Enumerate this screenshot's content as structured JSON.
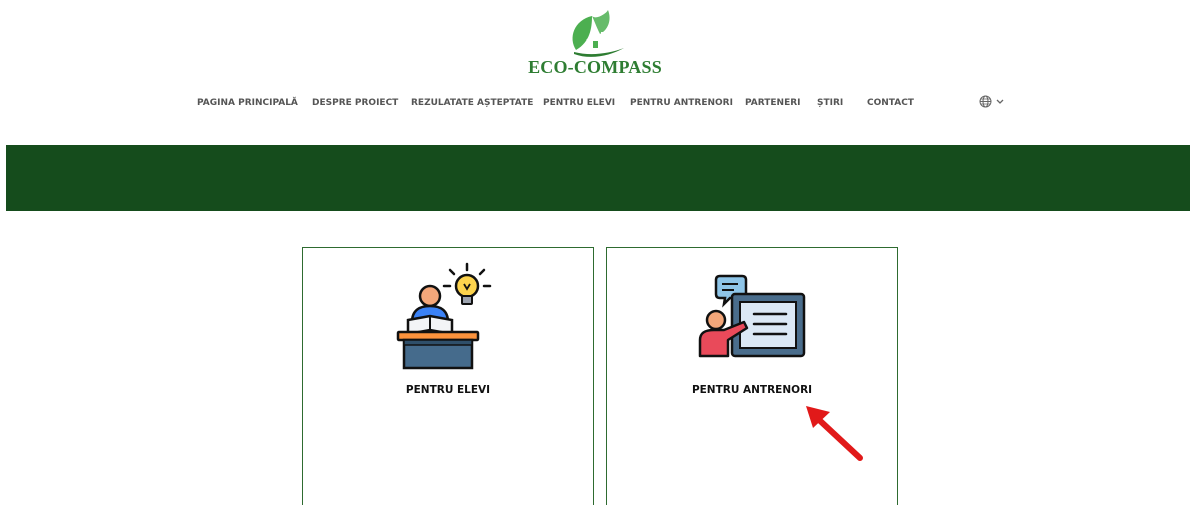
{
  "brand": {
    "name": "ECO-COMPASS",
    "color": "#2e7d32"
  },
  "nav": {
    "items": [
      "PAGINA PRINCIPALĂ",
      "DESPRE PROIECT",
      "REZULATATE AȘTEPTATE",
      "PENTRU ELEVI",
      "PENTRU ANTRENORI",
      "PARTENERI",
      "ȘTIRI",
      "CONTACT"
    ],
    "language_icon": "globe-icon"
  },
  "banner": {
    "color": "#154c1c"
  },
  "cards": [
    {
      "title": "PENTRU ELEVI",
      "icon": "student-desk-lightbulb-icon"
    },
    {
      "title": "PENTRU ANTRENORI",
      "icon": "trainer-presentation-icon"
    }
  ],
  "annotation": {
    "icon": "red-arrow-icon",
    "color": "#e11919"
  }
}
